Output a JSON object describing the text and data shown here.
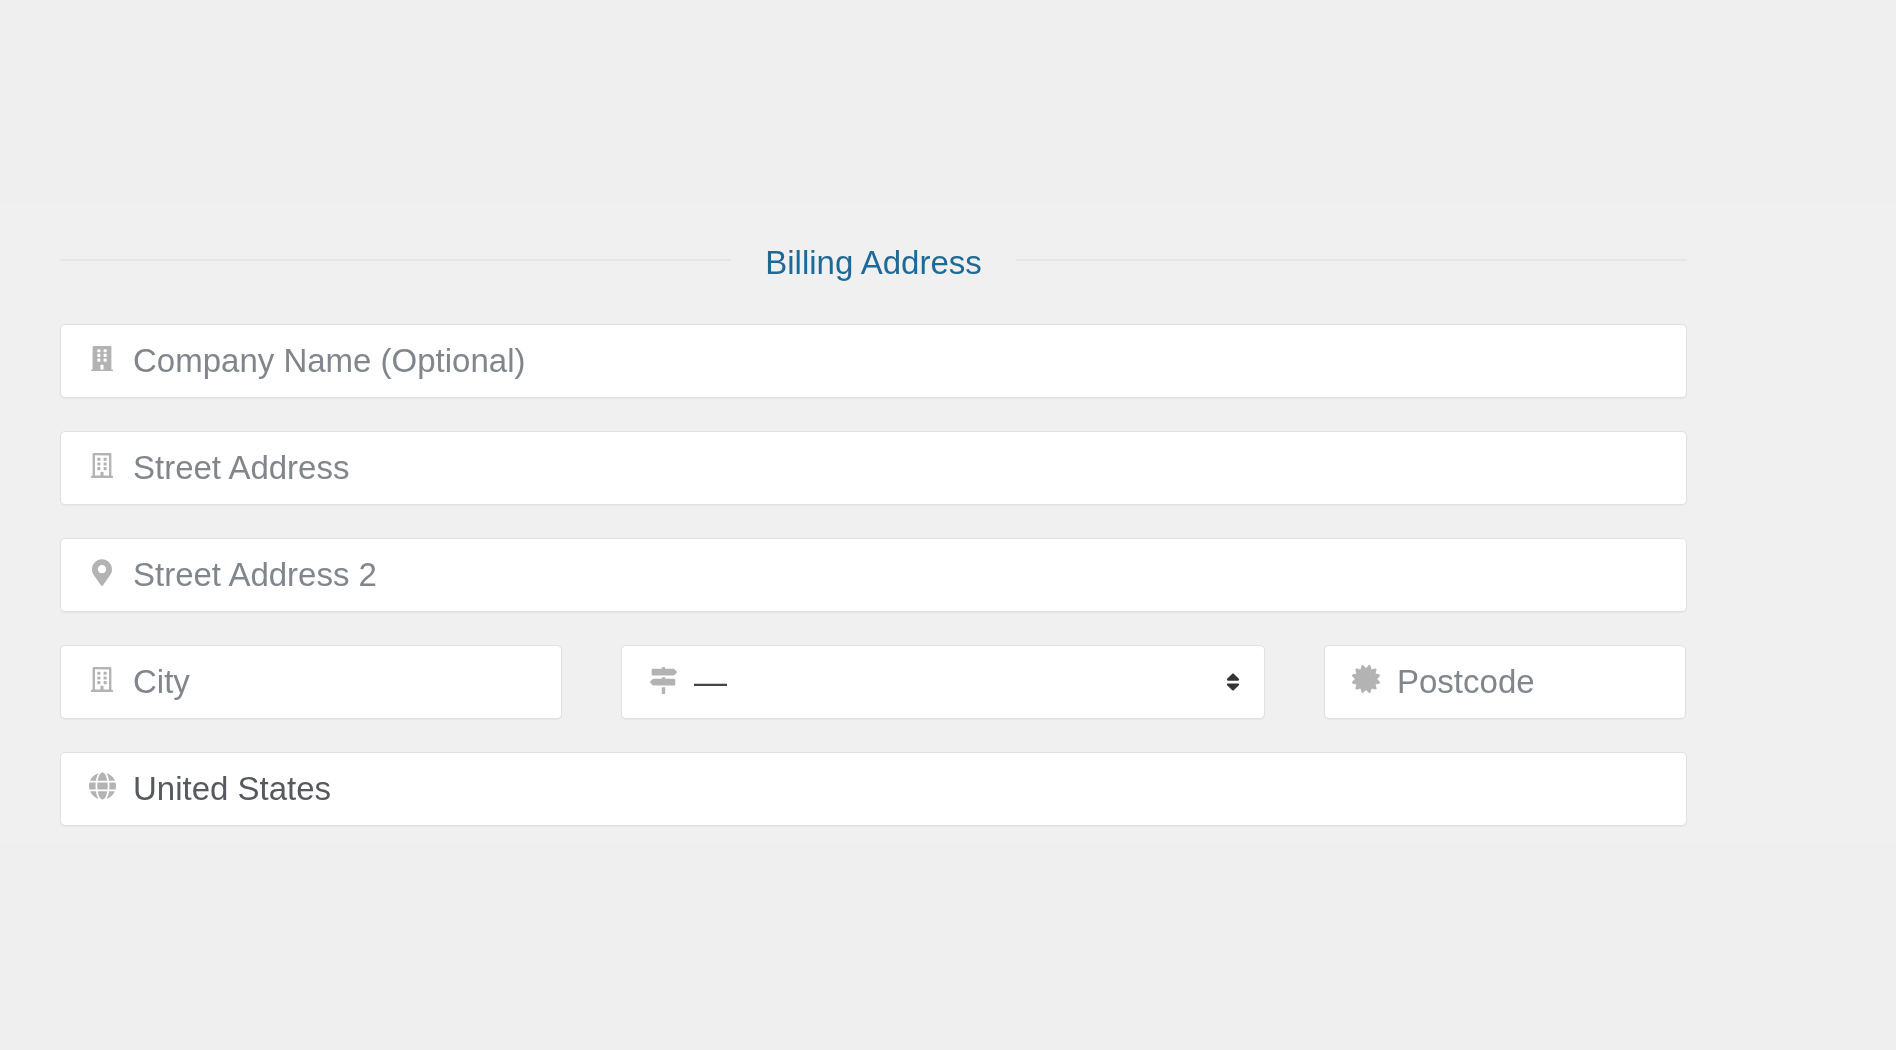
{
  "section": {
    "title": "Billing Address"
  },
  "rows": [
    [
      {
        "kind": "text",
        "placeholder": "Company Name (Optional)"
      }
    ],
    [
      {
        "kind": "text",
        "placeholder": "Street Address"
      }
    ],
    [
      {
        "kind": "text",
        "placeholder": "Street Address 2"
      }
    ],
    [
      {
        "kind": "text",
        "placeholder": "City"
      },
      {
        "kind": "select",
        "value": "—"
      },
      {
        "kind": "text",
        "placeholder": "Postcode"
      }
    ],
    [
      {
        "kind": "text",
        "value": "United States"
      }
    ]
  ]
}
